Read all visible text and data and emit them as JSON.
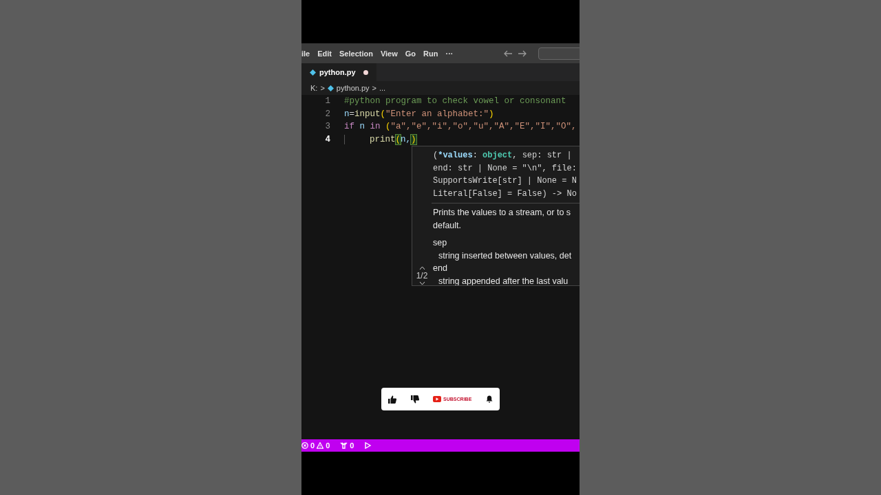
{
  "menu": [
    "ile",
    "Edit",
    "Selection",
    "View",
    "Go",
    "Run",
    "···"
  ],
  "tab": {
    "label": "python.py",
    "modified": true
  },
  "breadcrumb": [
    "K:",
    ">",
    "python.py",
    ">",
    "..."
  ],
  "lines": [
    {
      "number": "1",
      "active": false,
      "indent": false,
      "tokens": [
        {
          "text": "#python program to check vowel or consonant",
          "kind": "comment"
        }
      ]
    },
    {
      "number": "2",
      "active": false,
      "indent": false,
      "tokens": [
        {
          "text": "n",
          "kind": "var"
        },
        {
          "text": "=",
          "kind": "plain"
        },
        {
          "text": "input",
          "kind": "func"
        },
        {
          "text": "(",
          "kind": "paren"
        },
        {
          "text": "\"Enter an alphabet:\"",
          "kind": "string"
        },
        {
          "text": ")",
          "kind": "paren"
        }
      ]
    },
    {
      "number": "3",
      "active": false,
      "indent": false,
      "tokens": [
        {
          "text": "if",
          "kind": "keyword"
        },
        {
          "text": " n ",
          "kind": "var"
        },
        {
          "text": "in",
          "kind": "keyword"
        },
        {
          "text": " (",
          "kind": "paren"
        },
        {
          "text": "\"a\",\"e\",\"i\",\"o\",\"u\",\"A\",\"E\",\"I\",\"O\",",
          "kind": "string"
        }
      ]
    },
    {
      "number": "4",
      "active": true,
      "indent": true,
      "tokens": [
        {
          "text": "print",
          "kind": "func",
          "matched": false
        },
        {
          "text": "(",
          "kind": "paren",
          "matched": true
        },
        {
          "text": "n,",
          "kind": "var",
          "matched": false
        },
        {
          "text": ")",
          "kind": "paren",
          "matched": true
        }
      ]
    }
  ],
  "hover": {
    "pager": "1/2",
    "signature": [
      [
        {
          "text": "(",
          "kind": "plain"
        },
        {
          "text": "*values",
          "kind": "param"
        },
        {
          "text": ": ",
          "kind": "plain"
        },
        {
          "text": "object",
          "kind": "type"
        },
        {
          "text": ", sep: str |",
          "kind": "plain"
        }
      ],
      [
        {
          "text": "end: str | None = \"\\n\", file:",
          "kind": "plain"
        }
      ],
      [
        {
          "text": "SupportsWrite[str] | None = N",
          "kind": "plain"
        }
      ],
      [
        {
          "text": "Literal[False] = False) -> No",
          "kind": "plain"
        }
      ]
    ],
    "doc": [
      {
        "text": "Prints the values to a stream, or to s",
        "kind": "text"
      },
      {
        "text": "default.",
        "kind": "text"
      },
      {
        "text": "sep",
        "kind": "term"
      },
      {
        "text": "string inserted between values, det",
        "kind": "desc"
      },
      {
        "text": "end",
        "kind": "term"
      },
      {
        "text": "string appended after the last valu",
        "kind": "desc"
      }
    ]
  },
  "overlay": {
    "subscribe": "SUBSCRIBE"
  },
  "status": {
    "errors": "0",
    "warnings": "0",
    "ports": "0"
  }
}
